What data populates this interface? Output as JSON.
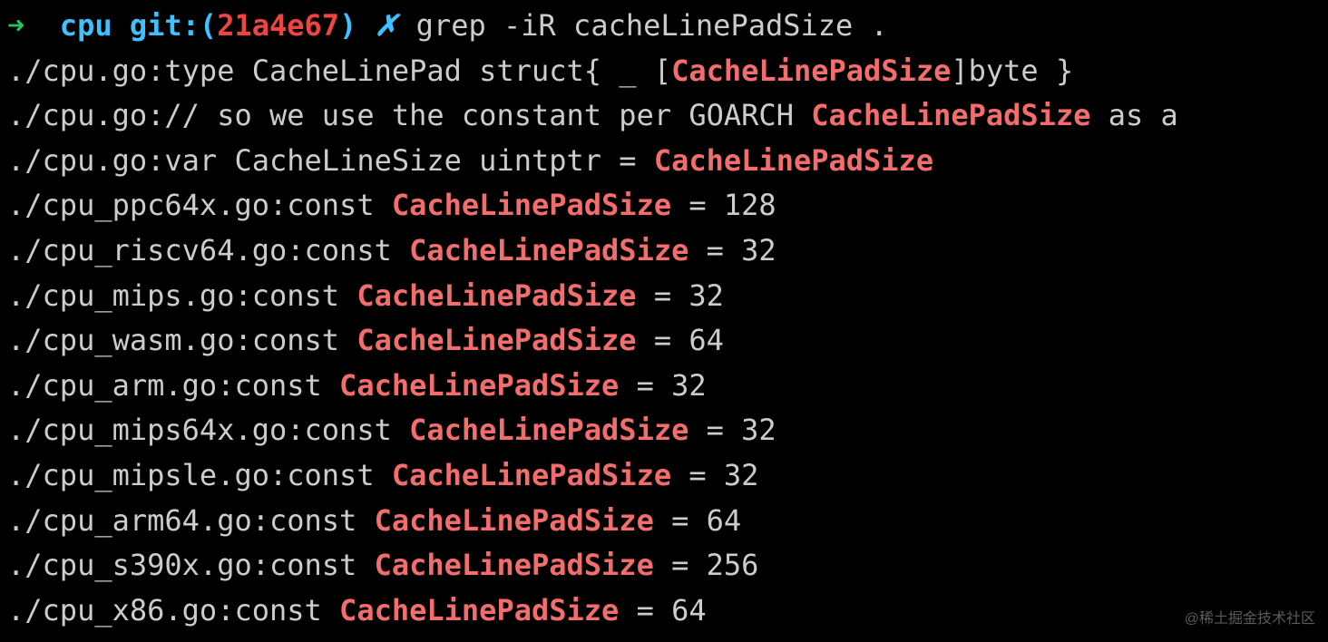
{
  "prompt": {
    "arrow": "➜",
    "dir": "cpu",
    "git_label": "git:",
    "paren_open": "(",
    "hash": "21a4e67",
    "paren_close": ")",
    "dirty": "✗",
    "command": "grep -iR cacheLinePadSize ."
  },
  "results": [
    {
      "file": "./cpu.go:",
      "pre": "type CacheLinePad struct{ _ [",
      "match": "CacheLinePadSize",
      "post": "]byte }"
    },
    {
      "file": "./cpu.go:",
      "pre": "// so we use the constant per GOARCH ",
      "match": "CacheLinePadSize",
      "post": " as a"
    },
    {
      "file": "./cpu.go:",
      "pre": "var CacheLineSize uintptr = ",
      "match": "CacheLinePadSize",
      "post": ""
    },
    {
      "file": "./cpu_ppc64x.go:",
      "pre": "const ",
      "match": "CacheLinePadSize",
      "post": " = 128"
    },
    {
      "file": "./cpu_riscv64.go:",
      "pre": "const ",
      "match": "CacheLinePadSize",
      "post": " = 32"
    },
    {
      "file": "./cpu_mips.go:",
      "pre": "const ",
      "match": "CacheLinePadSize",
      "post": " = 32"
    },
    {
      "file": "./cpu_wasm.go:",
      "pre": "const ",
      "match": "CacheLinePadSize",
      "post": " = 64"
    },
    {
      "file": "./cpu_arm.go:",
      "pre": "const ",
      "match": "CacheLinePadSize",
      "post": " = 32"
    },
    {
      "file": "./cpu_mips64x.go:",
      "pre": "const ",
      "match": "CacheLinePadSize",
      "post": " = 32"
    },
    {
      "file": "./cpu_mipsle.go:",
      "pre": "const ",
      "match": "CacheLinePadSize",
      "post": " = 32"
    },
    {
      "file": "./cpu_arm64.go:",
      "pre": "const ",
      "match": "CacheLinePadSize",
      "post": " = 64"
    },
    {
      "file": "./cpu_s390x.go:",
      "pre": "const ",
      "match": "CacheLinePadSize",
      "post": " = 256"
    },
    {
      "file": "./cpu_x86.go:",
      "pre": "const ",
      "match": "CacheLinePadSize",
      "post": " = 64"
    }
  ],
  "watermark": "@稀土掘金技术社区"
}
